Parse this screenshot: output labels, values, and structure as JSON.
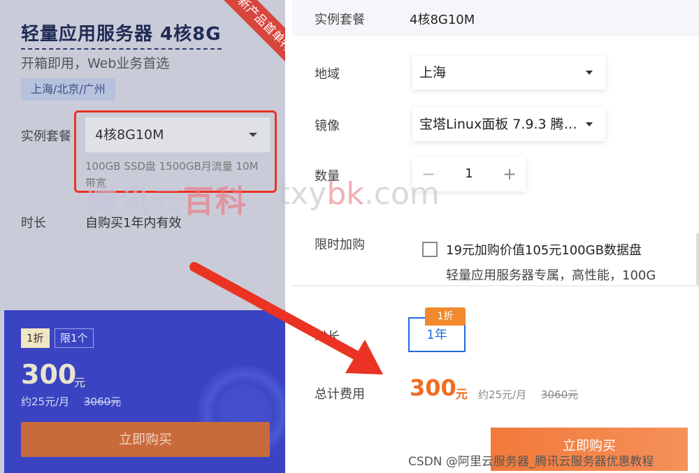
{
  "left": {
    "ribbon": "新产品首单特惠",
    "title": "轻量应用服务器 4核8G",
    "subtitle": "开箱即用，Web业务首选",
    "regions": "上海/北京/广州",
    "spec_label": "实例套餐",
    "spec_value": "4核8G10M",
    "spec_desc": "100GB SSD盘 1500GB月流量 10M带宽",
    "duration_label": "时长",
    "duration_value": "自购买1年内有效",
    "badge_discount": "1折",
    "badge_limit": "限1个",
    "price": "300",
    "price_unit": "元",
    "monthly": "约25元/月",
    "original_price": "3060元",
    "buy_label": "立即购买"
  },
  "right": {
    "spec_label": "实例套餐",
    "spec_value": "4核8G10M",
    "region_label": "地域",
    "region_value": "上海",
    "image_label": "镜像",
    "image_value": "宝塔Linux面板 7.9.3 腾…",
    "qty_label": "数量",
    "qty_minus": "−",
    "qty_value": "1",
    "qty_plus": "+",
    "addon_label": "限时加购",
    "addon_title": "19元加购价值105元100GB数据盘",
    "addon_desc": "轻量应用服务器专属，高性能，100G",
    "duration_label": "时长",
    "duration_option": "1年",
    "duration_badge": "1折",
    "total_label": "总计费用",
    "total_price": "300",
    "total_unit": "元",
    "total_monthly": "约25元/月",
    "total_original": "3060元",
    "buy_label": "立即购买"
  },
  "watermark": {
    "cn_1": "腾讯云",
    "cn_2": "百科",
    "en_1": "txy",
    "en_2": "bk",
    "en_3": ".com"
  },
  "credit": "CSDN @阿里云服务器_腾讯云服务器优惠教程",
  "colors": {
    "accent_orange": "#f26b1d",
    "accent_blue": "#1f6be0",
    "highlight_red": "#ea3323"
  }
}
